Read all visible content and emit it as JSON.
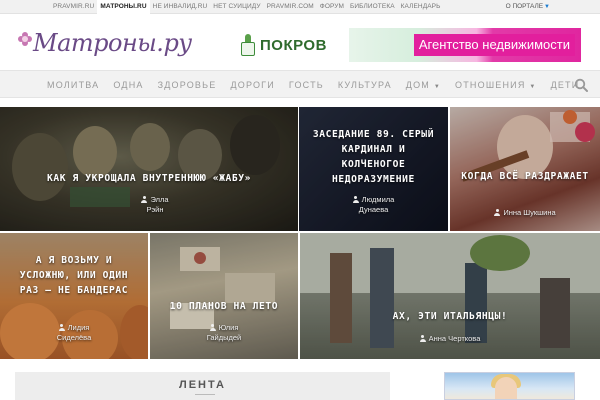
{
  "topbar": {
    "links": [
      "PRAVMIR.RU",
      "МАТРОНЫ.RU",
      "НЕ ИНВАЛИД.RU",
      "НЕТ СУИЦИДУ",
      "PRAVMIR.COM",
      "ФОРУМ",
      "БИБЛИОТЕКА",
      "КАЛЕНДАРЬ"
    ],
    "active_index": 1,
    "portal_label": "О ПОРТАЛЕ"
  },
  "header": {
    "logo_text": "Матроны.ру",
    "pokrov_label": "ПОКРОВ",
    "banner_text": "Агентство недвижимости"
  },
  "nav": {
    "items": [
      {
        "label": "МОЛИТВА"
      },
      {
        "label": "ОДНА"
      },
      {
        "label": "ЗДОРОВЬЕ"
      },
      {
        "label": "ДОРОГИ"
      },
      {
        "label": "ГОСТЬ"
      },
      {
        "label": "КУЛЬТУРА"
      },
      {
        "label": "ДОМ",
        "dropdown": true
      },
      {
        "label": "ОТНОШЕНИЯ",
        "dropdown": true
      },
      {
        "label": "ДЕТИ"
      }
    ]
  },
  "tiles": [
    {
      "title": "Как я укрощала внутреннюю «жабу»",
      "author_line1": "Элла",
      "author_line2": "Рэйн"
    },
    {
      "title": "Заседание 89. Серый кардинал и колченогое недоразумение",
      "author_line1": "Людмила",
      "author_line2": "Дунаева"
    },
    {
      "title": "Когда всё раздражает",
      "author_line1": "Инна Шукшина",
      "author_line2": ""
    },
    {
      "title": "А я возьму и усложню, или Один раз — не Бандерас",
      "author_line1": "Лидия",
      "author_line2": "Сиделёва"
    },
    {
      "title": "10 планов на лето",
      "author_line1": "Юлия",
      "author_line2": "Гайдыдей"
    },
    {
      "title": "Ах, эти итальянцы!",
      "author_line1": "Анна Черткова",
      "author_line2": ""
    }
  ],
  "feed": {
    "heading": "ЛЕНТА"
  },
  "colors": {
    "accent_purple": "#6a4a86",
    "banner_pink": "#e21f9d",
    "pokrov_green": "#2f6b2d",
    "nav_bg": "#f2f2f2"
  }
}
